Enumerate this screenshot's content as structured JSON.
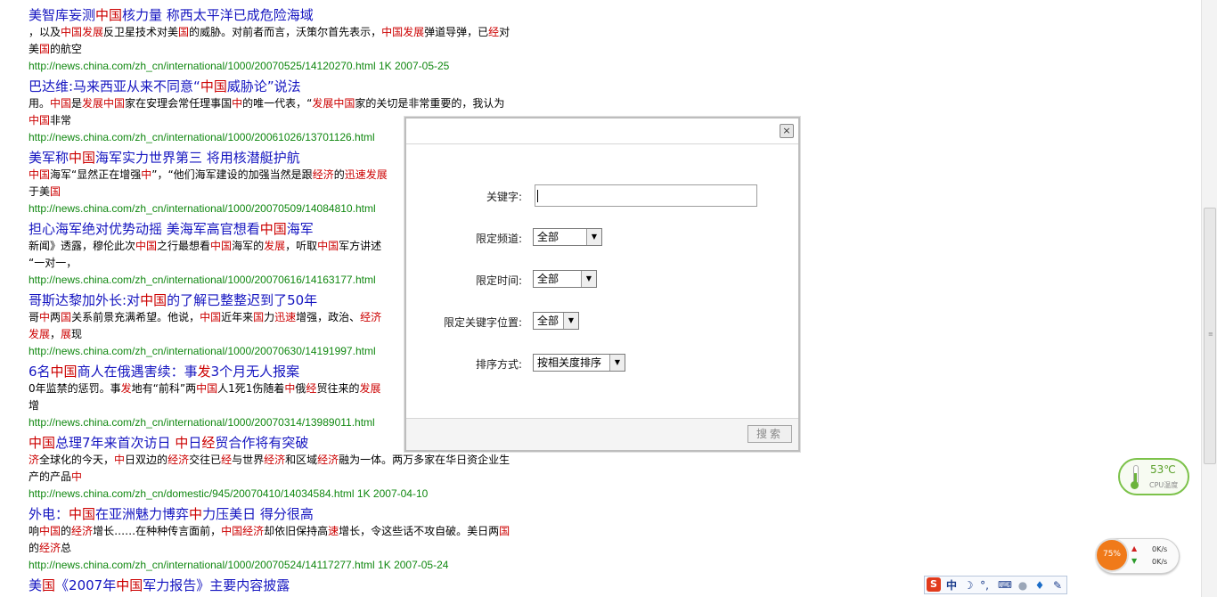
{
  "results": [
    {
      "title": [
        [
          "美智库妄测",
          ""
        ],
        [
          "中国",
          "hl"
        ],
        [
          "核力量 称西太平洋已成危险海域",
          ""
        ]
      ],
      "snippet1": [
        [
          "，以及",
          ""
        ],
        [
          "中国发展",
          "hl"
        ],
        [
          "反卫星技术对美",
          ""
        ],
        [
          "国",
          "hl"
        ],
        [
          "的威胁。对前者而言，沃策尔首先表示，",
          ""
        ],
        [
          "中国发展",
          "hl"
        ],
        [
          "弹道导弹，已",
          ""
        ],
        [
          "经",
          "hl"
        ],
        [
          "对",
          ""
        ]
      ],
      "snippet2": [
        [
          "美",
          ""
        ],
        [
          "国",
          "hl"
        ],
        [
          "的航空",
          ""
        ]
      ],
      "url": "http://news.china.com/zh_cn/international/1000/20070525/14120270.html 1K 2007-05-25"
    },
    {
      "title": [
        [
          "巴达维:马来西亚从来不同意“",
          ""
        ],
        [
          "中国",
          "hl"
        ],
        [
          "威胁论”说法",
          ""
        ]
      ],
      "snippet1": [
        [
          "用。",
          ""
        ],
        [
          "中国",
          "hl"
        ],
        [
          "是",
          ""
        ],
        [
          "发展中国",
          "hl"
        ],
        [
          "家在安理会常任理事国",
          ""
        ],
        [
          "中",
          "hl"
        ],
        [
          "的唯一代表，“",
          ""
        ],
        [
          "发展中国",
          "hl"
        ],
        [
          "家的关切是非常重要的，我认为",
          ""
        ]
      ],
      "snippet2": [
        [
          "中国",
          "hl"
        ],
        [
          "非常",
          ""
        ]
      ],
      "url": "http://news.china.com/zh_cn/international/1000/20061026/13701126.html"
    },
    {
      "title": [
        [
          "美军称",
          ""
        ],
        [
          "中国",
          "hl"
        ],
        [
          "海军实力世界第三 将用核潜艇护航",
          ""
        ]
      ],
      "snippet1": [
        [
          "中国",
          "hl"
        ],
        [
          "海军“显然正在增强",
          ""
        ],
        [
          "中",
          "hl"
        ],
        [
          "”，“他们海军建设的加强当然是跟",
          ""
        ],
        [
          "经济",
          "hl"
        ],
        [
          "的",
          ""
        ],
        [
          "迅速发展",
          "hl"
        ]
      ],
      "snippet2": [
        [
          "于美",
          ""
        ],
        [
          "国",
          "hl"
        ]
      ],
      "url": "http://news.china.com/zh_cn/international/1000/20070509/14084810.html"
    },
    {
      "title": [
        [
          "担心海军绝对优势动摇 美海军高官想看",
          ""
        ],
        [
          "中国",
          "hl"
        ],
        [
          "海军",
          ""
        ]
      ],
      "snippet1": [
        [
          "新闻》透露，穆伦此次",
          ""
        ],
        [
          "中国",
          "hl"
        ],
        [
          "之行最想看",
          ""
        ],
        [
          "中国",
          "hl"
        ],
        [
          "海军的",
          ""
        ],
        [
          "发展",
          "hl"
        ],
        [
          "，听取",
          ""
        ],
        [
          "中国",
          "hl"
        ],
        [
          "军方讲述",
          ""
        ]
      ],
      "snippet2": [
        [
          "“一对一，",
          ""
        ]
      ],
      "url": "http://news.china.com/zh_cn/international/1000/20070616/14163177.html"
    },
    {
      "title": [
        [
          "哥斯达黎加外长:对",
          ""
        ],
        [
          "中国",
          "hl"
        ],
        [
          "的了解已整整迟到了50年",
          ""
        ]
      ],
      "snippet1": [
        [
          "哥",
          ""
        ],
        [
          "中",
          "hl"
        ],
        [
          "两",
          ""
        ],
        [
          "国",
          "hl"
        ],
        [
          "关系前景充满希望。他说，",
          ""
        ],
        [
          "中国",
          "hl"
        ],
        [
          "近年来",
          ""
        ],
        [
          "国",
          "hl"
        ],
        [
          "力",
          ""
        ],
        [
          "迅速",
          "hl"
        ],
        [
          "增强，政治、",
          ""
        ],
        [
          "经济",
          "hl"
        ]
      ],
      "snippet2": [
        [
          "发展",
          "hl"
        ],
        [
          "，",
          ""
        ],
        [
          "展",
          "hl"
        ],
        [
          "现",
          ""
        ]
      ],
      "url": "http://news.china.com/zh_cn/international/1000/20070630/14191997.html"
    },
    {
      "title": [
        [
          "6名",
          ""
        ],
        [
          "中国",
          "hl"
        ],
        [
          "商人在俄遇害续：事",
          ""
        ],
        [
          "发",
          "hl"
        ],
        [
          "3个月无人报案",
          ""
        ]
      ],
      "snippet1": [
        [
          "0年监禁的惩罚。事",
          ""
        ],
        [
          "发",
          "hl"
        ],
        [
          "地有“前科”两",
          ""
        ],
        [
          "中国",
          "hl"
        ],
        [
          "人1死1伤随着",
          ""
        ],
        [
          "中",
          "hl"
        ],
        [
          "俄",
          ""
        ],
        [
          "经",
          "hl"
        ],
        [
          "贸往来的",
          ""
        ],
        [
          "发展",
          "hl"
        ]
      ],
      "snippet2": [
        [
          "增",
          ""
        ]
      ],
      "url": "http://news.china.com/zh_cn/international/1000/20070314/13989011.html"
    },
    {
      "title": [
        [
          "中国",
          "hl"
        ],
        [
          "总理7年来首次访日 ",
          ""
        ],
        [
          "中",
          "hl"
        ],
        [
          "日",
          ""
        ],
        [
          "经",
          "hl"
        ],
        [
          "贸合作将有突破",
          ""
        ]
      ],
      "snippet1": [
        [
          "济",
          "hl"
        ],
        [
          "全球化的今天，",
          ""
        ],
        [
          "中",
          "hl"
        ],
        [
          "日双边的",
          ""
        ],
        [
          "经济",
          "hl"
        ],
        [
          "交往已",
          ""
        ],
        [
          "经",
          "hl"
        ],
        [
          "与世界",
          ""
        ],
        [
          "经济",
          "hl"
        ],
        [
          "和区域",
          ""
        ],
        [
          "经济",
          "hl"
        ],
        [
          "融为一体。两万多家在华日资企业生",
          ""
        ]
      ],
      "snippet2": [
        [
          "产的产品",
          ""
        ],
        [
          "中",
          "hl"
        ]
      ],
      "url": "http://news.china.com/zh_cn/domestic/945/20070410/14034584.html 1K 2007-04-10"
    },
    {
      "title": [
        [
          "外电：",
          ""
        ],
        [
          "中国",
          "hl"
        ],
        [
          "在亚洲魅力博弈",
          ""
        ],
        [
          "中",
          "hl"
        ],
        [
          "力压美日 得分很高",
          ""
        ]
      ],
      "snippet1": [
        [
          "响",
          ""
        ],
        [
          "中国",
          "hl"
        ],
        [
          "的",
          ""
        ],
        [
          "经济",
          "hl"
        ],
        [
          "增长……在种种传言面前，",
          ""
        ],
        [
          "中国经济",
          "hl"
        ],
        [
          "却依旧保持高",
          ""
        ],
        [
          "速",
          "hl"
        ],
        [
          "增长，令这些话不攻自破。美日两",
          ""
        ],
        [
          "国",
          "hl"
        ]
      ],
      "snippet2": [
        [
          "的",
          ""
        ],
        [
          "经济",
          "hl"
        ],
        [
          "总",
          ""
        ]
      ],
      "url": "http://news.china.com/zh_cn/international/1000/20070524/14117277.html 1K 2007-05-24"
    },
    {
      "title": [
        [
          "美",
          ""
        ],
        [
          "国",
          "hl"
        ],
        [
          "《2007年",
          ""
        ],
        [
          "中国",
          "hl"
        ],
        [
          "军力报告》主要内容披露",
          ""
        ]
      ],
      "snippet1": [],
      "snippet2": [],
      "url": ""
    }
  ],
  "dialog": {
    "close_label": "×",
    "keyword_label": "关键字:",
    "keyword_value": "",
    "channel_label": "限定频道:",
    "channel_value": "全部",
    "time_label": "限定时间:",
    "time_value": "全部",
    "position_label": "限定关键字位置:",
    "position_value": "全部",
    "sort_label": "排序方式:",
    "sort_value": "按相关度排序",
    "search_label": "搜索"
  },
  "cpu_widget": {
    "temperature": "53℃",
    "label": "CPU温度"
  },
  "net_widget": {
    "usage": "75%",
    "up_speed": "0K/s",
    "down_speed": "0K/s"
  },
  "ime_bar": {
    "logo": "S",
    "lang": "中",
    "accent_color": "#e23b1c"
  }
}
